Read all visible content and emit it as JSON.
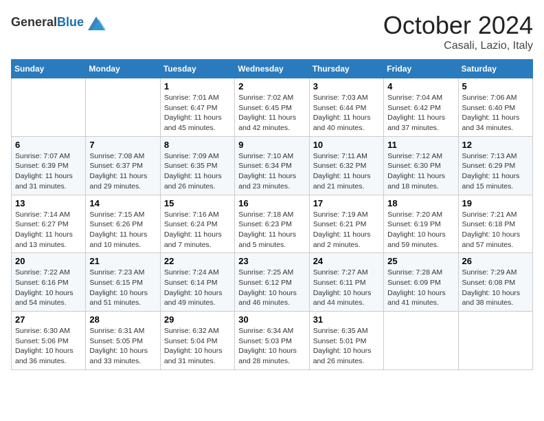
{
  "header": {
    "logo": {
      "text_general": "General",
      "text_blue": "Blue"
    },
    "title": "October 2024",
    "location": "Casali, Lazio, Italy"
  },
  "weekdays": [
    "Sunday",
    "Monday",
    "Tuesday",
    "Wednesday",
    "Thursday",
    "Friday",
    "Saturday"
  ],
  "weeks": [
    [
      null,
      null,
      {
        "day": "1",
        "sunrise": "7:01 AM",
        "sunset": "6:47 PM",
        "daylight": "11 hours and 45 minutes."
      },
      {
        "day": "2",
        "sunrise": "7:02 AM",
        "sunset": "6:45 PM",
        "daylight": "11 hours and 42 minutes."
      },
      {
        "day": "3",
        "sunrise": "7:03 AM",
        "sunset": "6:44 PM",
        "daylight": "11 hours and 40 minutes."
      },
      {
        "day": "4",
        "sunrise": "7:04 AM",
        "sunset": "6:42 PM",
        "daylight": "11 hours and 37 minutes."
      },
      {
        "day": "5",
        "sunrise": "7:06 AM",
        "sunset": "6:40 PM",
        "daylight": "11 hours and 34 minutes."
      }
    ],
    [
      {
        "day": "6",
        "sunrise": "7:07 AM",
        "sunset": "6:39 PM",
        "daylight": "11 hours and 31 minutes."
      },
      {
        "day": "7",
        "sunrise": "7:08 AM",
        "sunset": "6:37 PM",
        "daylight": "11 hours and 29 minutes."
      },
      {
        "day": "8",
        "sunrise": "7:09 AM",
        "sunset": "6:35 PM",
        "daylight": "11 hours and 26 minutes."
      },
      {
        "day": "9",
        "sunrise": "7:10 AM",
        "sunset": "6:34 PM",
        "daylight": "11 hours and 23 minutes."
      },
      {
        "day": "10",
        "sunrise": "7:11 AM",
        "sunset": "6:32 PM",
        "daylight": "11 hours and 21 minutes."
      },
      {
        "day": "11",
        "sunrise": "7:12 AM",
        "sunset": "6:30 PM",
        "daylight": "11 hours and 18 minutes."
      },
      {
        "day": "12",
        "sunrise": "7:13 AM",
        "sunset": "6:29 PM",
        "daylight": "11 hours and 15 minutes."
      }
    ],
    [
      {
        "day": "13",
        "sunrise": "7:14 AM",
        "sunset": "6:27 PM",
        "daylight": "11 hours and 13 minutes."
      },
      {
        "day": "14",
        "sunrise": "7:15 AM",
        "sunset": "6:26 PM",
        "daylight": "11 hours and 10 minutes."
      },
      {
        "day": "15",
        "sunrise": "7:16 AM",
        "sunset": "6:24 PM",
        "daylight": "11 hours and 7 minutes."
      },
      {
        "day": "16",
        "sunrise": "7:18 AM",
        "sunset": "6:23 PM",
        "daylight": "11 hours and 5 minutes."
      },
      {
        "day": "17",
        "sunrise": "7:19 AM",
        "sunset": "6:21 PM",
        "daylight": "11 hours and 2 minutes."
      },
      {
        "day": "18",
        "sunrise": "7:20 AM",
        "sunset": "6:19 PM",
        "daylight": "10 hours and 59 minutes."
      },
      {
        "day": "19",
        "sunrise": "7:21 AM",
        "sunset": "6:18 PM",
        "daylight": "10 hours and 57 minutes."
      }
    ],
    [
      {
        "day": "20",
        "sunrise": "7:22 AM",
        "sunset": "6:16 PM",
        "daylight": "10 hours and 54 minutes."
      },
      {
        "day": "21",
        "sunrise": "7:23 AM",
        "sunset": "6:15 PM",
        "daylight": "10 hours and 51 minutes."
      },
      {
        "day": "22",
        "sunrise": "7:24 AM",
        "sunset": "6:14 PM",
        "daylight": "10 hours and 49 minutes."
      },
      {
        "day": "23",
        "sunrise": "7:25 AM",
        "sunset": "6:12 PM",
        "daylight": "10 hours and 46 minutes."
      },
      {
        "day": "24",
        "sunrise": "7:27 AM",
        "sunset": "6:11 PM",
        "daylight": "10 hours and 44 minutes."
      },
      {
        "day": "25",
        "sunrise": "7:28 AM",
        "sunset": "6:09 PM",
        "daylight": "10 hours and 41 minutes."
      },
      {
        "day": "26",
        "sunrise": "7:29 AM",
        "sunset": "6:08 PM",
        "daylight": "10 hours and 38 minutes."
      }
    ],
    [
      {
        "day": "27",
        "sunrise": "6:30 AM",
        "sunset": "5:06 PM",
        "daylight": "10 hours and 36 minutes."
      },
      {
        "day": "28",
        "sunrise": "6:31 AM",
        "sunset": "5:05 PM",
        "daylight": "10 hours and 33 minutes."
      },
      {
        "day": "29",
        "sunrise": "6:32 AM",
        "sunset": "5:04 PM",
        "daylight": "10 hours and 31 minutes."
      },
      {
        "day": "30",
        "sunrise": "6:34 AM",
        "sunset": "5:03 PM",
        "daylight": "10 hours and 28 minutes."
      },
      {
        "day": "31",
        "sunrise": "6:35 AM",
        "sunset": "5:01 PM",
        "daylight": "10 hours and 26 minutes."
      },
      null,
      null
    ]
  ]
}
